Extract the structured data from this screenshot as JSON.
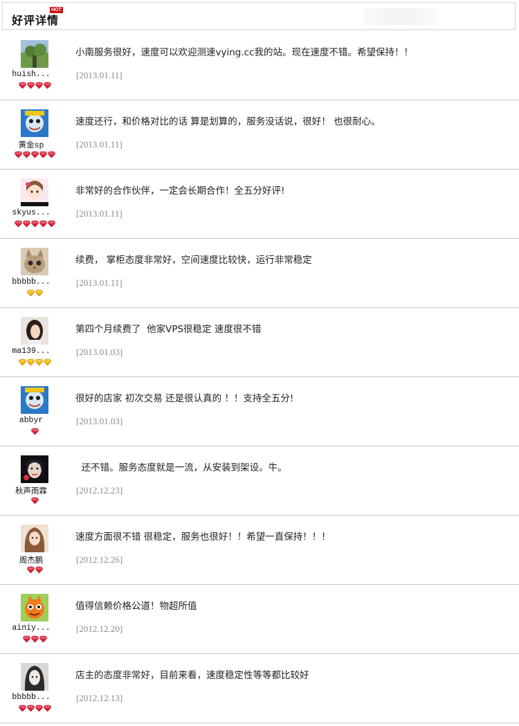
{
  "header": {
    "title": "好评详情",
    "badge": "HOT"
  },
  "reviews": [
    {
      "user": "huish...",
      "avatar": "landscape",
      "gems": "red",
      "gem_count": 4,
      "comment": "小南服务很好，速度可以欢迎测速vying.cc我的站。现在速度不错。希望保持！！",
      "date": "[2013.01.11]"
    },
    {
      "user": "黄金sp",
      "avatar": "cartoon-blue",
      "gems": "red",
      "gem_count": 5,
      "comment": "速度还行，和价格对比的话 算是划算的，服务没话说，很好！ 也很耐心。",
      "date": "[2013.01.11]"
    },
    {
      "user": "skyus...",
      "avatar": "anime-girl",
      "gems": "red",
      "gem_count": 5,
      "comment": "非常好的合作伙伴，一定会长期合作！全五分好评!",
      "date": "[2013.01.11]"
    },
    {
      "user": "bbbbb...",
      "avatar": "cat",
      "gems": "yellow",
      "gem_count": 2,
      "comment": "续费， 掌柜态度非常好，空间速度比较快，运行非常稳定",
      "date": "[2013.01.11]"
    },
    {
      "user": "ma139...",
      "avatar": "woman",
      "gems": "yellow",
      "gem_count": 4,
      "comment": "第四个月续费了  他家VPS很稳定 速度很不错",
      "date": "[2013.01.03]"
    },
    {
      "user": "abbyr",
      "avatar": "cartoon-blue",
      "gems": "red",
      "gem_count": 1,
      "comment": "很好的店家 初次交易 还是很认真的 ！！支持全五分!",
      "date": "[2013.01.03]"
    },
    {
      "user": "秋声雨霖",
      "avatar": "dark-face",
      "gems": "red",
      "gem_count": 1,
      "comment": "  还不错。服务态度就是一流，从安装到架设。牛。",
      "date": "[2012.12.23]"
    },
    {
      "user": "周杰鹏",
      "avatar": "portrait-girl",
      "gems": "red",
      "gem_count": 2,
      "comment": "速度方面很不错 很稳定，服务也很好！！希望一直保持！！！",
      "date": "[2012.12.26]"
    },
    {
      "user": "ainiy...",
      "avatar": "orange-monster",
      "gems": "red",
      "gem_count": 3,
      "comment": "值得信赖价格公道！物超所值",
      "date": "[2012.12.20]"
    },
    {
      "user": "bbbbb...",
      "avatar": "girl-bw",
      "gems": "red",
      "gem_count": 4,
      "comment": "店主的态度非常好，目前来看，速度稳定性等等都比较好",
      "date": "[2012.12.13]"
    }
  ],
  "colors": {
    "gem_red": "#e0223a",
    "gem_yellow": "#f2b705",
    "hot_badge": "#cc1111",
    "divider": "#c8c8c8",
    "date_text": "#8a8a8a"
  }
}
